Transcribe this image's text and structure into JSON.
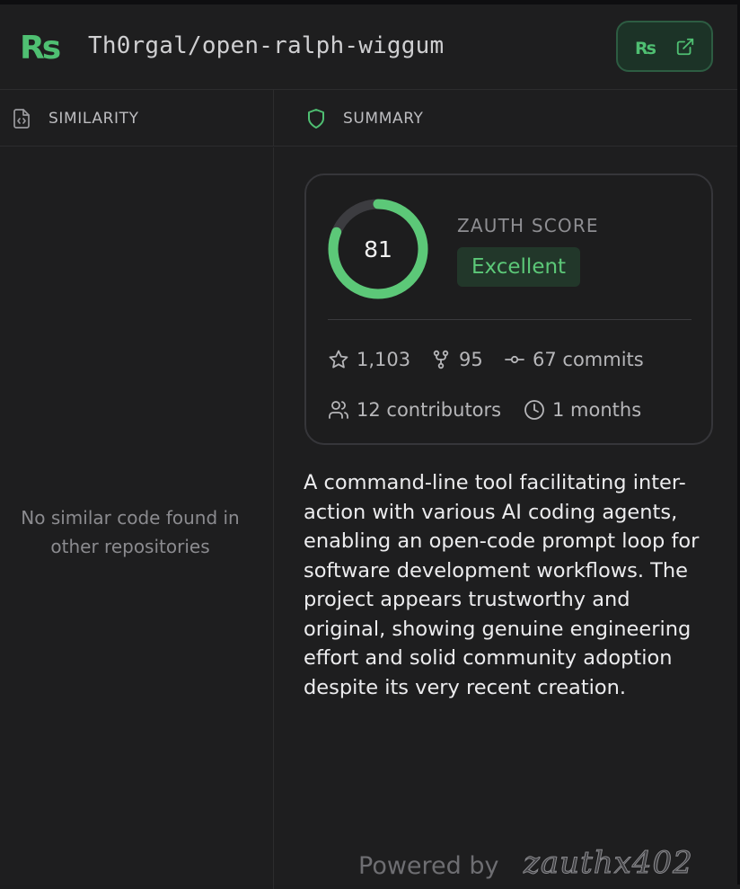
{
  "header": {
    "logo_text": "Rs",
    "repo_title": "Th0rgal/open-ralph-wiggum",
    "open_button": {
      "logo_text": "Rs",
      "icon": "external-link-icon"
    }
  },
  "tabs": [
    {
      "label": "SIMILARITY",
      "icon": "code-file-icon"
    },
    {
      "label": "SUMMARY",
      "icon": "shield-icon"
    }
  ],
  "similarity": {
    "empty_message": "No similar code found in other repositories"
  },
  "score_card": {
    "score": "81",
    "score_value": 81,
    "score_max": 100,
    "label": "ZAUTH SCORE",
    "rating": "Excellent",
    "stats": {
      "stars": "1,103",
      "forks": "95",
      "commits": "67 commits",
      "contributors": "12 contributors",
      "age": "1 months"
    }
  },
  "summary": {
    "text": "A command-line tool facilitating inter-action with various AI coding agents, enabling an open-code prompt loop for software development workflows. The project appears trustworthy and original, showing genuine engineering effort and solid community adoption despite its very recent creation."
  },
  "footer": {
    "powered_by": "Powered by",
    "brand": "zauthx402"
  },
  "colors": {
    "accent_green": "#5cc878",
    "background": "#1e1e1f",
    "badge_bg": "#22372a",
    "button_bg": "#1c3327",
    "border": "#2c2c2e"
  }
}
